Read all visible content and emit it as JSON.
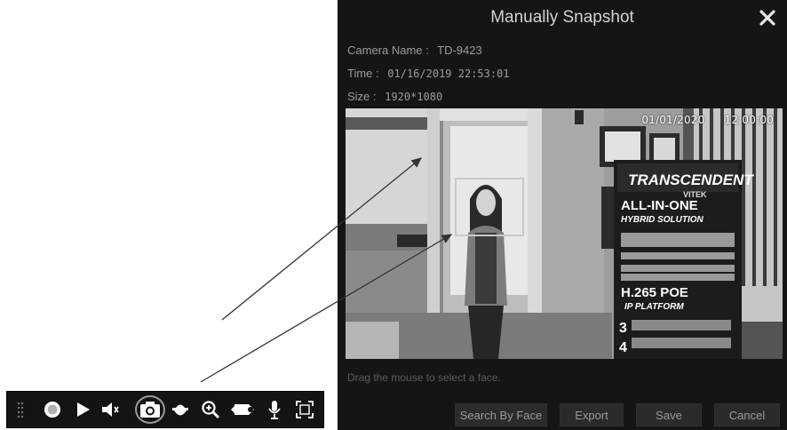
{
  "dialog": {
    "title": "Manually Snapshot",
    "camera_name_label": "Camera Name :",
    "camera_name_value": "TD-9423",
    "time_label": "Time :",
    "time_value": "01/16/2019 22:53:01",
    "size_label": "Size :",
    "size_value": "1920*1080",
    "osd_date": "01/01/2020",
    "osd_time": "12:00:00",
    "banner_brand": "TRANSCENDENT",
    "banner_vitek": "VITEK",
    "banner_line1": "ALL-IN-ONE",
    "banner_line2": "HYBRID SOLUTION",
    "banner_line3": "H.265 POE",
    "banner_line4": "IP PLATFORM",
    "hint": "Drag the mouse to select a face.",
    "buttons": {
      "search_by_face": "Search By Face",
      "export": "Export",
      "save": "Save",
      "cancel": "Cancel"
    }
  },
  "toolbar": {
    "icons": [
      "drag-handle-icon",
      "record-icon",
      "play-icon",
      "volume-icon",
      "snapshot-icon",
      "dome-camera-icon",
      "zoom-in-icon",
      "3d-ptz-icon",
      "microphone-icon",
      "face-detect-icon"
    ],
    "highlighted": "snapshot-icon"
  },
  "colors": {
    "dialog_bg": "#151515",
    "title_text": "#d2d2d2",
    "label_text": "#9c9c9c",
    "button_bg": "#2b2b2b",
    "toolbar_bg": "#141414",
    "face_box": "#c8c8c8"
  }
}
